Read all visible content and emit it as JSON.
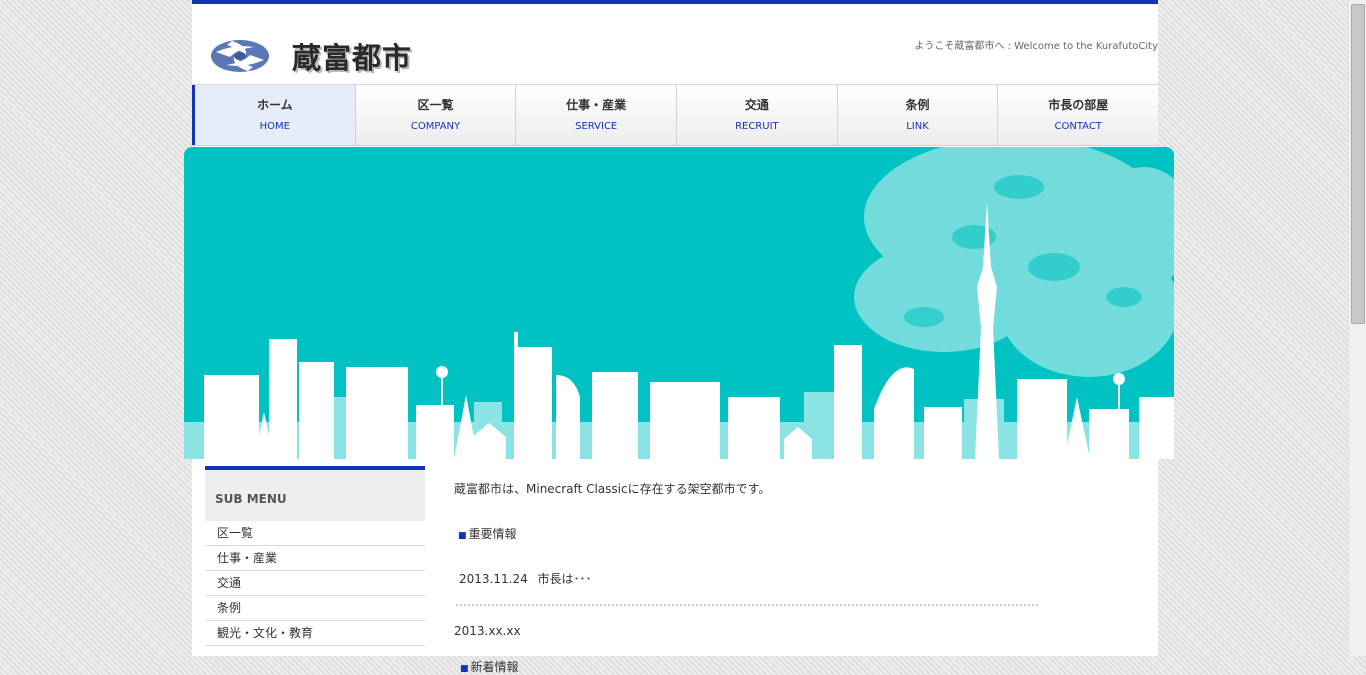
{
  "header": {
    "logo_text": "蔵富都市",
    "welcome": "ようこそ蔵富都市へ : Welcome to the KurafutoCity"
  },
  "nav": {
    "items": [
      {
        "jp": "ホーム",
        "en": "HOME"
      },
      {
        "jp": "区一覧",
        "en": "COMPANY"
      },
      {
        "jp": "仕事・産業",
        "en": "SERVICE"
      },
      {
        "jp": "交通",
        "en": "RECRUIT"
      },
      {
        "jp": "条例",
        "en": "LINK"
      },
      {
        "jp": "市長の部屋",
        "en": "CONTACT"
      }
    ]
  },
  "sidebar": {
    "title": "SUB MENU",
    "items": [
      "区一覧",
      "仕事・産業",
      "交通",
      "条例",
      "観光・文化・教育"
    ]
  },
  "content": {
    "intro": "蔵富都市は、Minecraft Classicに存在する架空都市です。",
    "important_heading": "重要情報",
    "news": [
      {
        "date": "2013.11.24",
        "text": "市長は･･･"
      }
    ],
    "date_placeholder": "2013.xx.xx",
    "next_heading": "新着情報"
  },
  "colors": {
    "accent": "#1233b8",
    "hero_bg": "#00c2c2"
  }
}
